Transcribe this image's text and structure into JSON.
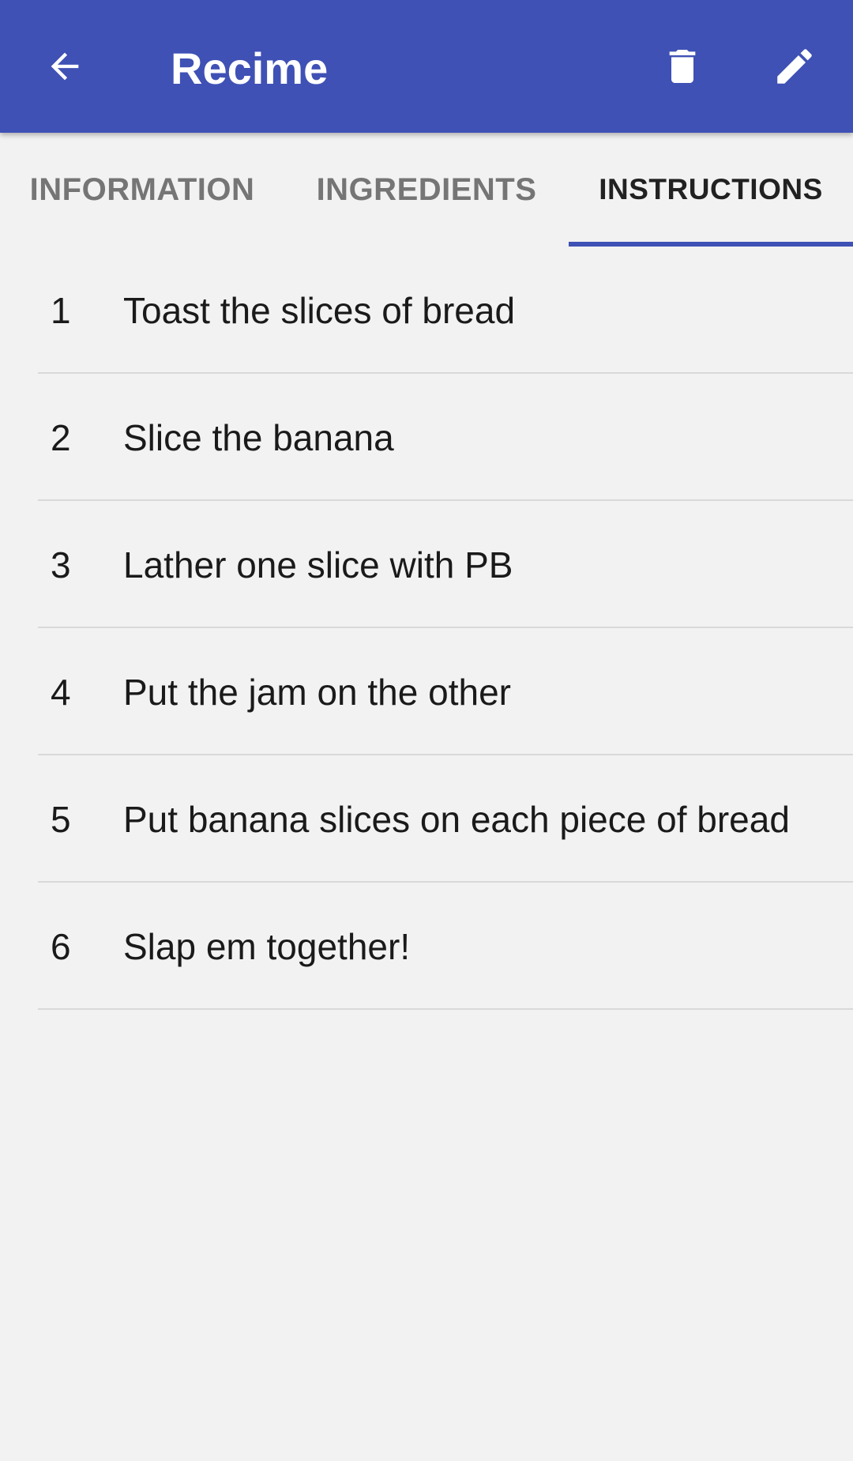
{
  "app_bar": {
    "title": "Recime",
    "icons": {
      "back": "arrow-back-icon",
      "delete": "trash-icon",
      "edit": "pencil-icon"
    },
    "background_color": "#3f51b5"
  },
  "tabs": [
    {
      "label": "INFORMATION",
      "selected": false
    },
    {
      "label": "INGREDIENTS",
      "selected": false
    },
    {
      "label": "INSTRUCTIONS",
      "selected": true
    }
  ],
  "instructions": [
    {
      "number": "1",
      "text": "Toast the slices of bread"
    },
    {
      "number": "2",
      "text": "Slice the banana"
    },
    {
      "number": "3",
      "text": "Lather one slice with PB"
    },
    {
      "number": "4",
      "text": "Put the jam on the other"
    },
    {
      "number": "5",
      "text": "Put banana slices on each piece of bread"
    },
    {
      "number": "6",
      "text": "Slap em together!"
    }
  ]
}
